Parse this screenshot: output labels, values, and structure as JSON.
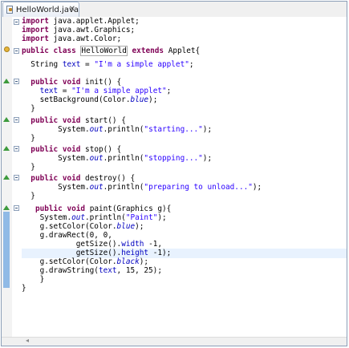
{
  "tab": {
    "title": "HelloWorld.java",
    "close": "✕"
  },
  "code": {
    "l1": {
      "a": "import",
      "b": " java.applet.Applet;"
    },
    "l2": {
      "a": "import",
      "b": " java.awt.Graphics;"
    },
    "l3": {
      "a": "import",
      "b": " java.awt.Color;"
    },
    "l4": {
      "a": "public",
      "b": "class",
      "c": "HelloWorld",
      "d": "extends",
      "e": " Applet{"
    },
    "l5": {
      "a": "  String ",
      "b": "text",
      "c": " = ",
      "d": "\"I'm a simple applet\"",
      "e": ";"
    },
    "l6": {
      "a": "public",
      "b": "void",
      "c": " init() {"
    },
    "l7": {
      "a": "text",
      "b": " = ",
      "c": "\"I'm a simple applet\"",
      "d": ";"
    },
    "l8": {
      "a": "    setBackground(Color.",
      "b": "blue",
      "c": ");"
    },
    "l9": "  }",
    "l10": {
      "a": "public",
      "b": "void",
      "c": " start() {"
    },
    "l11": {
      "a": "        System.",
      "b": "out",
      "c": ".println(",
      "d": "\"starting...\"",
      "e": ");"
    },
    "l12": "  }",
    "l13": {
      "a": "public",
      "b": "void",
      "c": " stop() {"
    },
    "l14": {
      "a": "        System.",
      "b": "out",
      "c": ".println(",
      "d": "\"stopping...\"",
      "e": ");"
    },
    "l15": "  }",
    "l16": {
      "a": "public",
      "b": "void",
      "c": " destroy() {"
    },
    "l17": {
      "a": "        System.",
      "b": "out",
      "c": ".println(",
      "d": "\"preparing to unload...\"",
      "e": ");"
    },
    "l18": "  }",
    "l19": {
      "a": "public",
      "b": "void",
      "c": " paint(Graphics g){"
    },
    "l20": {
      "a": "    System.",
      "b": "out",
      "c": ".println(",
      "d": "\"Paint\"",
      "e": ");"
    },
    "l21": {
      "a": "    g.setColor(Color.",
      "b": "blue",
      "c": ");"
    },
    "l22": "    g.drawRect(0, 0,",
    "l23": {
      "a": "            getSize().",
      "b": "width",
      "c": " -1,"
    },
    "l24": {
      "a": "            getSize().",
      "b": "height",
      "c": " -1);"
    },
    "l25": {
      "a": "    g.setColor(Color.",
      "b": "black",
      "c": ");"
    },
    "l26": {
      "a": "    g.drawString(",
      "b": "text",
      "c": ", 15, 25);"
    },
    "l27": "    }",
    "l28": "}"
  },
  "scroll": {
    "left_arrow": "◂"
  }
}
